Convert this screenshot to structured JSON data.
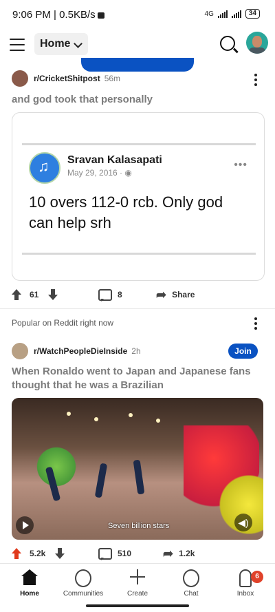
{
  "status_bar": {
    "time_speed": "9:06 PM | 0.5KB/s",
    "net_label": "4G",
    "battery": "34"
  },
  "header": {
    "feed_selector": "Home"
  },
  "post1": {
    "subreddit": "r/CricketShitpost",
    "age": "56m",
    "title": "and god took that personally",
    "embed": {
      "author": "Sravan Kalasapati",
      "date": "May 29, 2016 ·",
      "more": "•••",
      "text": "10 overs 112-0 rcb. Only god can help srh"
    },
    "votes": "61",
    "comments": "8",
    "share": "Share"
  },
  "section_label": "Popular on Reddit right now",
  "post2": {
    "subreddit": "r/WatchPeopleDieInside",
    "age": "2h",
    "join": "Join",
    "title": "When Ronaldo went to Japan and Japanese fans thought that he was a Brazilian",
    "video_caption": "Seven billion stars",
    "votes": "5.2k",
    "comments": "510",
    "shares": "1.2k"
  },
  "bottom_nav": {
    "items": [
      {
        "label": "Home"
      },
      {
        "label": "Communities"
      },
      {
        "label": "Create"
      },
      {
        "label": "Chat"
      },
      {
        "label": "Inbox"
      }
    ],
    "inbox_badge": "6"
  },
  "colors": {
    "accent_blue": "#0a52c2",
    "upvote_red": "#e03a1c",
    "badge_red": "#e0422a"
  }
}
